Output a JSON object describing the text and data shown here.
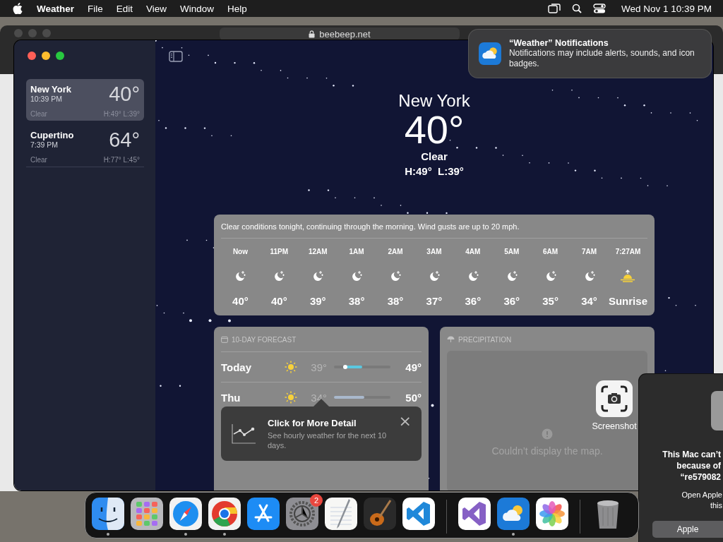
{
  "menu_bar": {
    "app_name": "Weather",
    "menus": [
      "File",
      "Edit",
      "View",
      "Window",
      "Help"
    ],
    "clock": "Wed Nov 1  10:39 PM"
  },
  "browser": {
    "address": "beebeep.net"
  },
  "notification": {
    "title": "“Weather” Notifications",
    "body": "Notifications may include alerts, sounds, and icon badges."
  },
  "sidebar": {
    "locations": [
      {
        "name": "New York",
        "time": "10:39 PM",
        "condition": "Clear",
        "temperature": "40°",
        "high": "H:49°",
        "low": "L:39°",
        "selected": true
      },
      {
        "name": "Cupertino",
        "time": "7:39 PM",
        "condition": "Clear",
        "temperature": "64°",
        "high": "H:77°",
        "low": "L:45°",
        "selected": false
      }
    ]
  },
  "current": {
    "city": "New York",
    "temperature": "40°",
    "condition": "Clear",
    "high": "H:49°",
    "low": "L:39°"
  },
  "hourly": {
    "summary": "Clear conditions tonight, continuing through the morning. Wind gusts are up to 20 mph.",
    "hours": [
      {
        "time": "Now",
        "kind": "moon",
        "temperature": "40°"
      },
      {
        "time": "11PM",
        "kind": "moon",
        "temperature": "40°"
      },
      {
        "time": "12AM",
        "kind": "moon",
        "temperature": "39°"
      },
      {
        "time": "1AM",
        "kind": "moon",
        "temperature": "38°"
      },
      {
        "time": "2AM",
        "kind": "moon",
        "temperature": "38°"
      },
      {
        "time": "3AM",
        "kind": "moon",
        "temperature": "37°"
      },
      {
        "time": "4AM",
        "kind": "moon",
        "temperature": "36°"
      },
      {
        "time": "5AM",
        "kind": "moon",
        "temperature": "36°"
      },
      {
        "time": "6AM",
        "kind": "moon",
        "temperature": "35°"
      },
      {
        "time": "7AM",
        "kind": "moon",
        "temperature": "34°"
      },
      {
        "time": "7:27AM",
        "kind": "sunrise",
        "temperature": "Sunrise"
      }
    ]
  },
  "ten_day": {
    "title": "10-DAY FORECAST",
    "days": [
      {
        "day": "Today",
        "kind": "sun",
        "low": "39°",
        "high": "49°",
        "now_marker": true,
        "color": "#5ac8e0"
      },
      {
        "day": "Thu",
        "kind": "sun",
        "low": "34°",
        "high": "50°",
        "now_marker": false,
        "color": "#a9b8cc"
      }
    ]
  },
  "tip": {
    "title": "Click for More Detail",
    "text": "See hourly weather for the next 10 days.",
    "close": "×"
  },
  "precipitation": {
    "title": "PRECIPITATION",
    "message": "Couldn’t display the map."
  },
  "screenshot_app": {
    "label": "Screenshot"
  },
  "dialog": {
    "lines": [
      "This Mac can’t",
      "because of",
      "“re579082"
    ],
    "note": [
      "Open Apple",
      "this"
    ],
    "button": "Apple"
  },
  "dock": {
    "items": [
      {
        "kind": "finder",
        "running": true
      },
      {
        "kind": "launchpad",
        "running": false
      },
      {
        "kind": "safari",
        "running": true
      },
      {
        "kind": "chrome",
        "running": true
      },
      {
        "kind": "appstore",
        "running": false
      },
      {
        "kind": "settings",
        "running": false,
        "badge": "2"
      },
      {
        "kind": "textedit",
        "running": false
      },
      {
        "kind": "garageband",
        "running": false
      },
      {
        "kind": "vscode",
        "running": false
      },
      {
        "kind": "separator"
      },
      {
        "kind": "visualstudio",
        "running": false
      },
      {
        "kind": "weather",
        "running": true
      },
      {
        "kind": "photos",
        "running": false
      },
      {
        "kind": "separator"
      },
      {
        "kind": "trash",
        "running": false
      }
    ]
  }
}
